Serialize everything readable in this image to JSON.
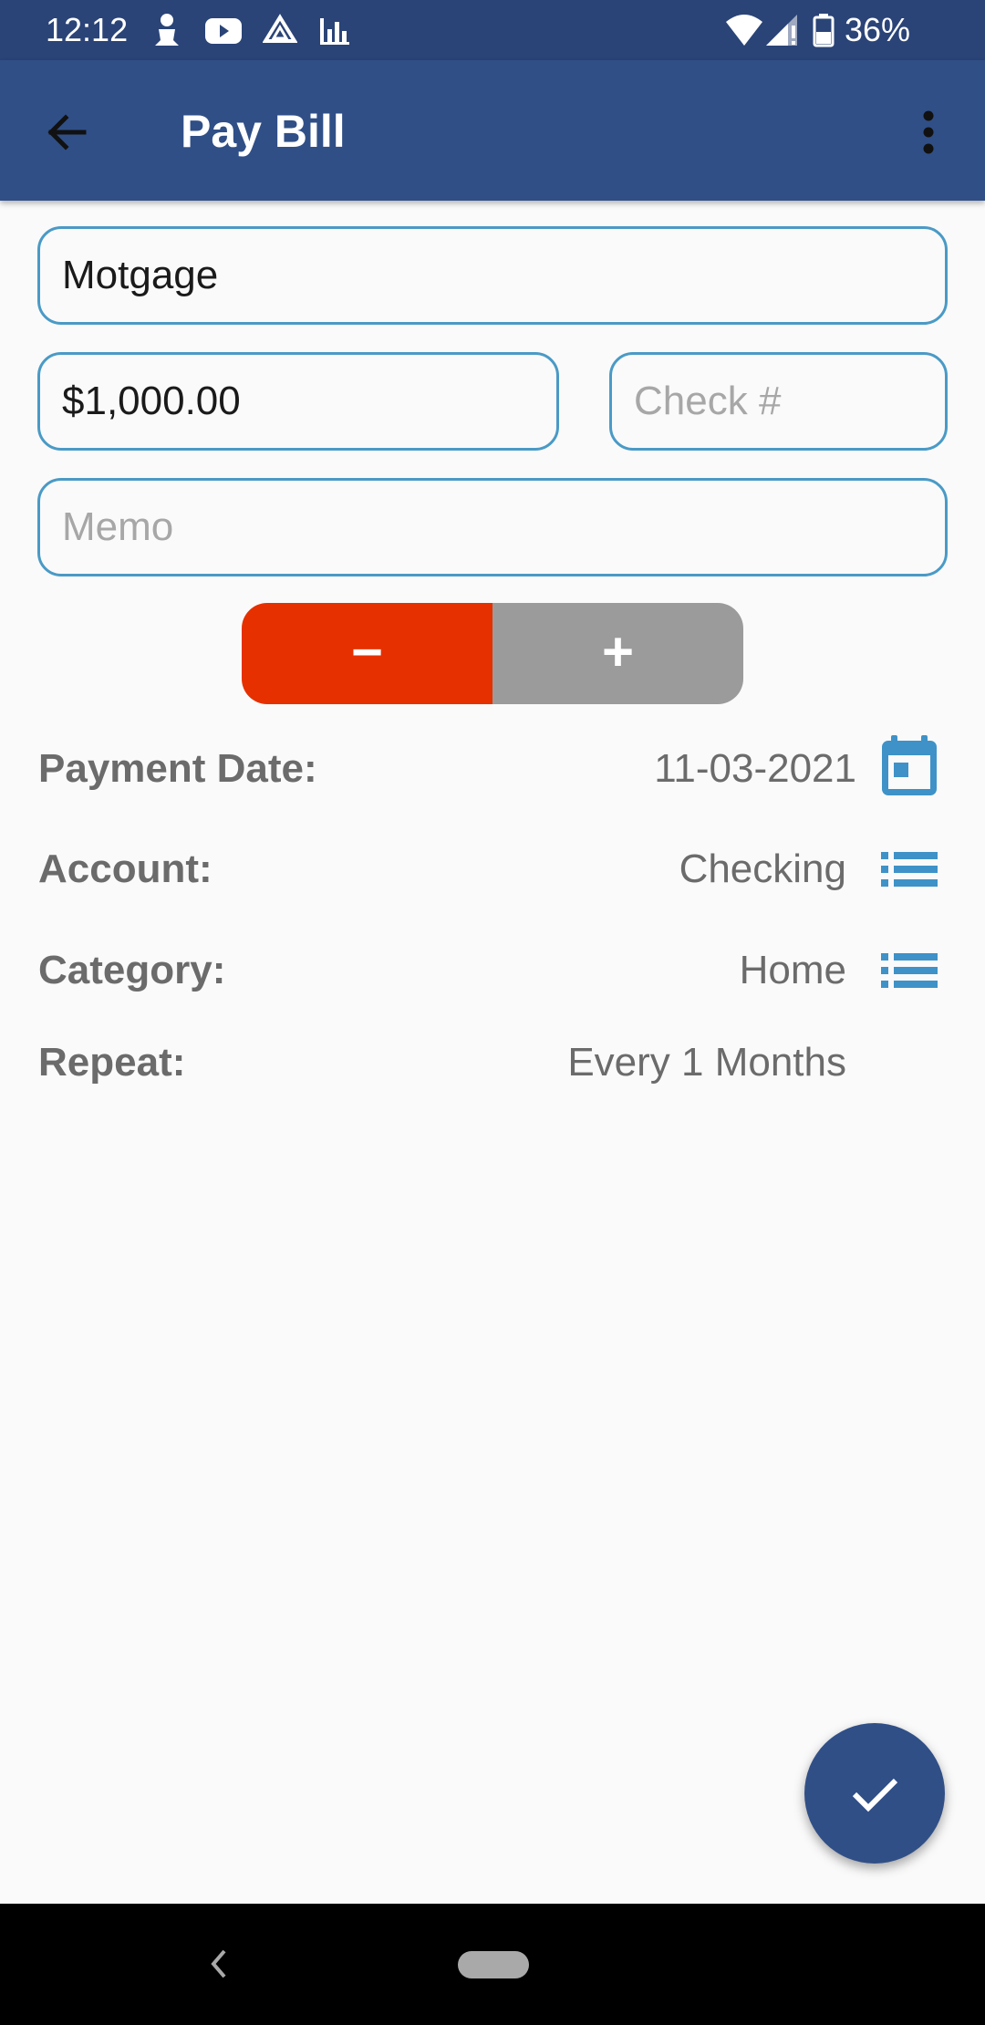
{
  "status_bar": {
    "time": "12:12",
    "battery": "36%",
    "icons": [
      "person-icon",
      "youtube-icon",
      "drive-icon",
      "chart-icon",
      "wifi-icon",
      "signal-icon",
      "battery-icon"
    ]
  },
  "app_bar": {
    "title": "Pay Bill",
    "back_icon": "arrow-back-icon",
    "menu_icon": "more-vert-icon"
  },
  "form": {
    "payee": {
      "value": "Motgage"
    },
    "amount": {
      "value": "$1,000.00"
    },
    "check_number": {
      "value": "",
      "placeholder": "Check #"
    },
    "memo": {
      "value": "",
      "placeholder": "Memo"
    }
  },
  "toggle": {
    "minus": "−",
    "plus": "+",
    "minus_color": "#e63000",
    "plus_color": "#9b9b9b"
  },
  "rows": {
    "payment_date": {
      "label": "Payment Date:",
      "value": "11-03-2021",
      "icon": "calendar-icon"
    },
    "account": {
      "label": "Account:",
      "value": "Checking",
      "icon": "list-icon"
    },
    "category": {
      "label": "Category:",
      "value": "Home",
      "icon": "list-icon"
    },
    "repeat": {
      "label": "Repeat:",
      "value": "Every 1 Months"
    }
  },
  "fab": {
    "icon": "check-icon"
  },
  "colors": {
    "status_bar": "#2a4477",
    "app_bar": "#304f87",
    "accent": "#3e92c7",
    "field_border": "#4a9ac6"
  }
}
